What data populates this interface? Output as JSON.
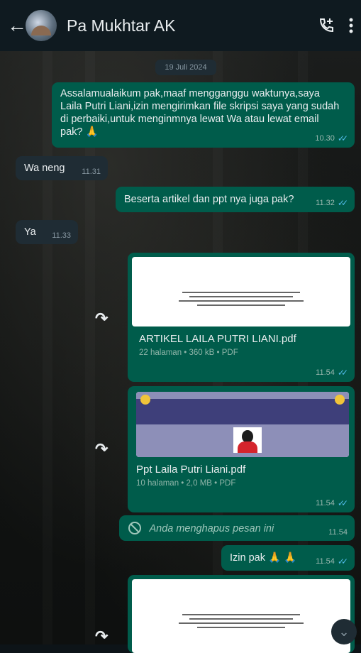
{
  "header": {
    "back_glyph": "←",
    "contact_name": "Pa Mukhtar AK"
  },
  "date_chip": "19 Juli 2024",
  "messages": [
    {
      "text": "Assalamualaikum pak,maaf mengganggu waktunya,saya Laila Putri Liani,izin mengirimkan file skripsi saya yang sudah di perbaiki,untuk menginmnya lewat Wa atau lewat email pak? 🙏",
      "time": "10.30"
    },
    {
      "text": "Wa neng",
      "time": "11.31"
    },
    {
      "text": "Beserta artikel dan ppt nya juga pak?",
      "time": "11.32"
    },
    {
      "text": "Ya",
      "time": "11.33"
    }
  ],
  "docs": [
    {
      "name": "ARTIKEL LAILA PUTRI LIANI.pdf",
      "info": "22 halaman • 360 kB • PDF",
      "time": "11.54"
    },
    {
      "name": "Ppt Laila Putri Liani.pdf",
      "info": "10 halaman • 2,0 MB • PDF",
      "time": "11.54"
    }
  ],
  "deleted": {
    "text": "Anda menghapus pesan ini",
    "time": "11.54"
  },
  "izin": {
    "text": "Izin pak 🙏 🙏",
    "time": "11.54"
  },
  "icons": {
    "forward": "↷",
    "scroll_down": "⌄"
  },
  "colors": {
    "outgoing_bubble": "#005c4b",
    "incoming_bubble": "#1f2c34",
    "read_tick": "#53bdeb"
  }
}
